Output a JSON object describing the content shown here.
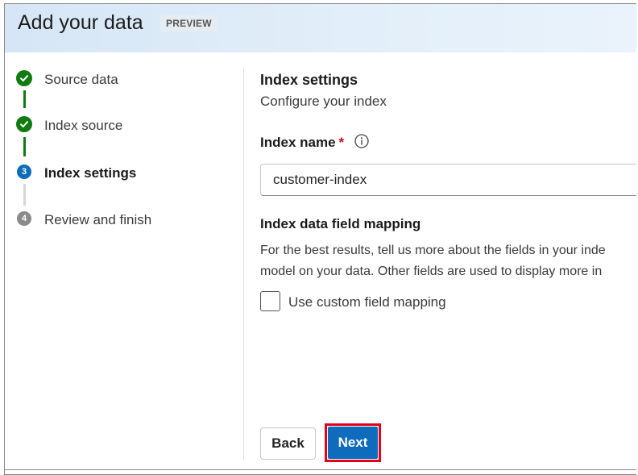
{
  "header": {
    "title": "Add your data",
    "badge": "PREVIEW"
  },
  "steps": [
    {
      "label": "Source data",
      "status": "complete",
      "icon": "check-icon"
    },
    {
      "label": "Index source",
      "status": "complete",
      "icon": "check-icon"
    },
    {
      "label": "Index settings",
      "status": "current",
      "number": "3"
    },
    {
      "label": "Review and finish",
      "status": "pending",
      "number": "4"
    }
  ],
  "main": {
    "title": "Index settings",
    "subtitle": "Configure your index",
    "index_name": {
      "label": "Index name",
      "required_mark": "*",
      "value": "customer-index",
      "info_icon": "info-icon"
    },
    "mapping": {
      "title": "Index data field mapping",
      "description_line1": "For the best results, tell us more about the fields in your inde",
      "description_line2": "model on your data. Other fields are used to display more in",
      "checkbox_label": "Use custom field mapping",
      "checkbox_checked": false
    }
  },
  "footer": {
    "back_label": "Back",
    "next_label": "Next"
  },
  "colors": {
    "accent": "#0f6cbd",
    "success": "#107c10",
    "required": "#c50f1f",
    "highlight": "#e0001b"
  }
}
